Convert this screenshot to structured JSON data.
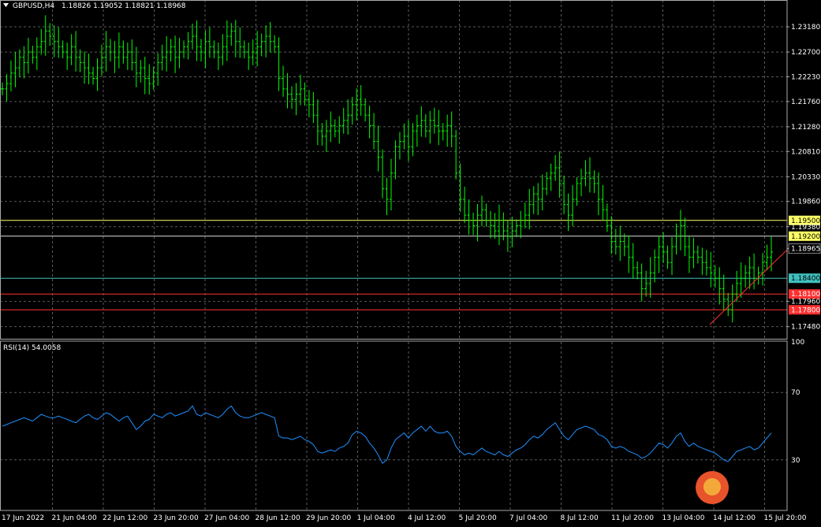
{
  "header": {
    "symbol": "GBPUSD,H4",
    "ohlc": "1.18826 1.19052 1.18821 1.18968"
  },
  "rsi_header": "RSI(14) 54.0058",
  "colors": {
    "background": "#000000",
    "grid": "#5a5a5a",
    "candle": "#00ff00",
    "rsi_line": "#1e90ff",
    "line_yellow": "#ffff66",
    "line_white": "#dddddd",
    "line_cyan": "#40c0c0",
    "line_red": "#ff3030",
    "trendline": "#ff3030"
  },
  "chart_data": [
    {
      "type": "candlestick",
      "symbol": "GBPUSD",
      "timeframe": "H4",
      "price_ticks": [
        "1.23180",
        "1.22700",
        "1.22230",
        "1.21760",
        "1.21280",
        "1.20810",
        "1.20330",
        "1.19860",
        "1.19380",
        "1.18965",
        "1.17960",
        "1.17480"
      ],
      "x_tick_labels": [
        "17 Jun 2022",
        "21 Jun 04:00",
        "22 Jun 12:00",
        "23 Jun 20:00",
        "27 Jun 04:00",
        "28 Jun 12:00",
        "29 Jun 20:00",
        "1 Jul 04:00",
        "4 Jul 12:00",
        "5 Jul 20:00",
        "7 Jul 04:00",
        "8 Jul 12:00",
        "11 Jul 20:00",
        "13 Jul 04:00",
        "14 Jul 12:00",
        "15 Jul 20:00"
      ],
      "ylim": [
        1.1725,
        1.2348
      ],
      "current_price": "1.18965",
      "horizontal_levels": [
        {
          "price": 1.195,
          "label": "1.19500",
          "color": "#ffff66"
        },
        {
          "price": 1.192,
          "label": "1.19200",
          "color": "#ffff66",
          "line_color": "#dddddd"
        },
        {
          "price": 1.184,
          "label": "1.18400",
          "color": "#40c0c0"
        },
        {
          "price": 1.181,
          "label": "1.18100",
          "color": "#ff3030"
        },
        {
          "price": 1.178,
          "label": "1.17800",
          "color": "#ff3030"
        }
      ],
      "closes": [
        1.22,
        1.221,
        1.223,
        1.224,
        1.226,
        1.225,
        1.227,
        1.226,
        1.228,
        1.229,
        1.231,
        1.23,
        1.229,
        1.228,
        1.227,
        1.226,
        1.228,
        1.226,
        1.225,
        1.224,
        1.223,
        1.222,
        1.224,
        1.226,
        1.228,
        1.227,
        1.226,
        1.228,
        1.226,
        1.227,
        1.225,
        1.223,
        1.224,
        1.222,
        1.221,
        1.223,
        1.225,
        1.226,
        1.227,
        1.228,
        1.226,
        1.227,
        1.228,
        1.229,
        1.23,
        1.228,
        1.227,
        1.229,
        1.228,
        1.227,
        1.226,
        1.228,
        1.23,
        1.231,
        1.229,
        1.228,
        1.227,
        1.226,
        1.227,
        1.228,
        1.229,
        1.23,
        1.229,
        1.228,
        1.222,
        1.22,
        1.219,
        1.218,
        1.219,
        1.22,
        1.218,
        1.217,
        1.215,
        1.212,
        1.211,
        1.212,
        1.213,
        1.212,
        1.213,
        1.214,
        1.215,
        1.217,
        1.218,
        1.217,
        1.215,
        1.213,
        1.21,
        1.207,
        1.201,
        1.199,
        1.204,
        1.209,
        1.21,
        1.211,
        1.209,
        1.212,
        1.213,
        1.214,
        1.212,
        1.214,
        1.213,
        1.212,
        1.212,
        1.213,
        1.211,
        1.204,
        1.199,
        1.196,
        1.195,
        1.194,
        1.196,
        1.197,
        1.195,
        1.194,
        1.193,
        1.195,
        1.193,
        1.192,
        1.193,
        1.194,
        1.195,
        1.196,
        1.198,
        1.2,
        1.199,
        1.201,
        1.203,
        1.204,
        1.205,
        1.202,
        1.198,
        1.196,
        1.199,
        1.202,
        1.203,
        1.204,
        1.203,
        1.202,
        1.199,
        1.197,
        1.194,
        1.191,
        1.19,
        1.191,
        1.19,
        1.188,
        1.186,
        1.185,
        1.182,
        1.183,
        1.185,
        1.188,
        1.19,
        1.189,
        1.187,
        1.19,
        1.192,
        1.194,
        1.19,
        1.188,
        1.189,
        1.188,
        1.187,
        1.186,
        1.185,
        1.184,
        1.182,
        1.18,
        1.178,
        1.181,
        1.183,
        1.184,
        1.185,
        1.186,
        1.184,
        1.185,
        1.187,
        1.188,
        1.189
      ],
      "rsi": {
        "name": "RSI(14)",
        "value": "54.0058",
        "levels": [
          "100",
          "70",
          "30",
          "0"
        ],
        "ylim": [
          0,
          100
        ],
        "values": [
          50,
          51,
          52,
          53,
          54,
          55,
          54,
          53,
          55,
          57,
          56,
          55,
          55,
          56,
          55,
          54,
          53,
          52,
          54,
          56,
          57,
          55,
          54,
          56,
          58,
          57,
          55,
          53,
          55,
          56,
          52,
          48,
          50,
          53,
          54,
          57,
          56,
          55,
          57,
          58,
          56,
          57,
          58,
          59,
          62,
          57,
          56,
          58,
          57,
          56,
          55,
          57,
          60,
          62,
          58,
          56,
          55,
          55,
          56,
          57,
          58,
          57,
          56,
          55,
          44,
          43,
          43,
          42,
          43,
          44,
          42,
          41,
          39,
          35,
          34,
          35,
          36,
          35,
          37,
          38,
          40,
          45,
          47,
          46,
          44,
          40,
          37,
          33,
          28,
          30,
          37,
          42,
          44,
          46,
          43,
          46,
          48,
          50,
          47,
          50,
          47,
          46,
          46,
          47,
          44,
          38,
          35,
          33,
          34,
          33,
          35,
          37,
          35,
          34,
          33,
          35,
          33,
          32,
          34,
          36,
          37,
          39,
          42,
          44,
          43,
          45,
          48,
          50,
          52,
          48,
          44,
          42,
          45,
          48,
          49,
          50,
          49,
          48,
          45,
          44,
          42,
          38,
          37,
          38,
          37,
          35,
          34,
          33,
          31,
          32,
          34,
          37,
          40,
          39,
          37,
          40,
          44,
          46,
          41,
          38,
          40,
          38,
          37,
          36,
          35,
          34,
          32,
          30,
          29,
          32,
          35,
          36,
          37,
          38,
          36,
          37,
          40,
          43,
          46
        ]
      }
    }
  ]
}
